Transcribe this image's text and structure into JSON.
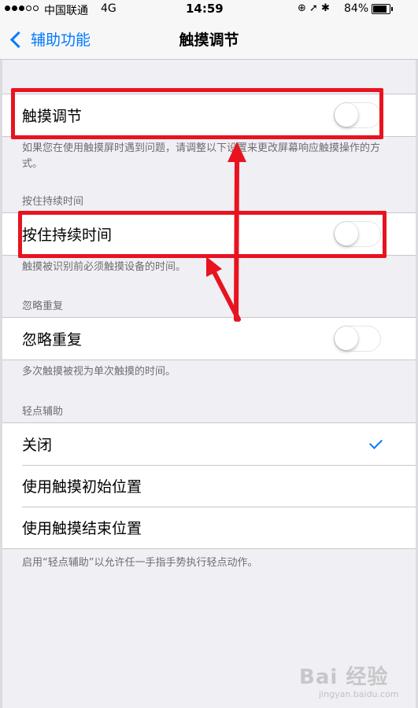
{
  "status_bar": {
    "carrier": "中国联通",
    "network": "4G",
    "time": "14:59",
    "icons": "⊕ ➚ ✱",
    "battery": "84%",
    "battery_level": 0.84
  },
  "nav": {
    "back_label": "辅助功能",
    "title": "触摸调节"
  },
  "sections": {
    "touch_accommodations": {
      "label": "触摸调节",
      "enabled": false,
      "footer": "如果您在使用触摸屏时遇到问题，请调整以下设置来更改屏幕响应触摸操作的方式。"
    },
    "hold_duration": {
      "header": "按住持续时间",
      "label": "按住持续时间",
      "enabled": false,
      "footer": "触摸被识别前必须触摸设备的时间。"
    },
    "ignore_repeat": {
      "header": "忽略重复",
      "label": "忽略重复",
      "enabled": false,
      "footer": "多次触摸被视为单次触摸的时间。"
    },
    "tap_assistance": {
      "header": "轻点辅助",
      "options": [
        {
          "label": "关闭",
          "selected": true
        },
        {
          "label": "使用触摸初始位置",
          "selected": false
        },
        {
          "label": "使用触摸结束位置",
          "selected": false
        }
      ],
      "footer": "启用“轻点辅助”以允许任一手指手势执行轻点动作。"
    }
  },
  "watermark": {
    "text": "Bai 经验",
    "sub": "jingyan.baidu.com"
  },
  "colors": {
    "accent": "#007aff",
    "annotation": "#e8131f",
    "background": "#efeff4"
  }
}
